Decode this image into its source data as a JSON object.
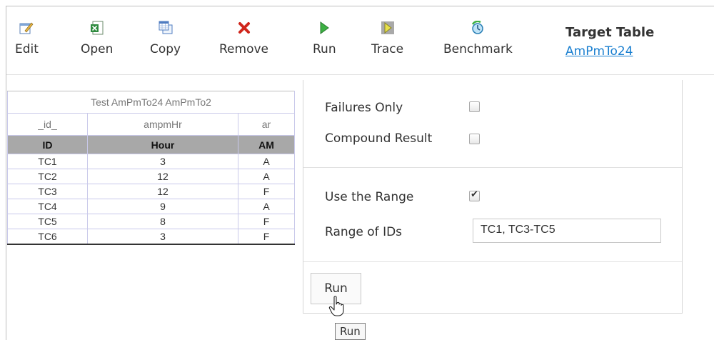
{
  "toolbar": {
    "items": [
      {
        "label": "Edit",
        "icon": "edit-icon"
      },
      {
        "label": "Open",
        "icon": "excel-icon"
      },
      {
        "label": "Copy",
        "icon": "copy-table-icon"
      },
      {
        "label": "Remove",
        "icon": "remove-x-icon"
      },
      {
        "label": "Run",
        "icon": "run-triangle-icon"
      },
      {
        "label": "Trace",
        "icon": "trace-icon"
      },
      {
        "label": "Benchmark",
        "icon": "benchmark-icon"
      }
    ],
    "target_title": "Target Table",
    "target_link": "AmPmTo24"
  },
  "table": {
    "caption": "Test AmPmTo24 AmPmTo2",
    "fields": [
      "_id_",
      "ampmHr",
      "ar"
    ],
    "headers": [
      "ID",
      "Hour",
      "AM"
    ],
    "rows": [
      [
        "TC1",
        "3",
        "A"
      ],
      [
        "TC2",
        "12",
        "A"
      ],
      [
        "TC3",
        "12",
        "F"
      ],
      [
        "TC4",
        "9",
        "A"
      ],
      [
        "TC5",
        "8",
        "F"
      ],
      [
        "TC6",
        "3",
        "F"
      ]
    ]
  },
  "panel": {
    "failures_only_label": "Failures Only",
    "failures_only_checked": false,
    "compound_result_label": "Compound Result",
    "compound_result_checked": false,
    "use_range_label": "Use the Range",
    "use_range_checked": true,
    "range_ids_label": "Range of IDs",
    "range_ids_value": "TC1, TC3-TC5",
    "run_button": "Run"
  },
  "tooltip": "Run",
  "colors": {
    "link": "#1a7fd0",
    "header_bg": "#a8a8a8",
    "remove_red": "#d0261c",
    "run_green": "#3cb043"
  }
}
